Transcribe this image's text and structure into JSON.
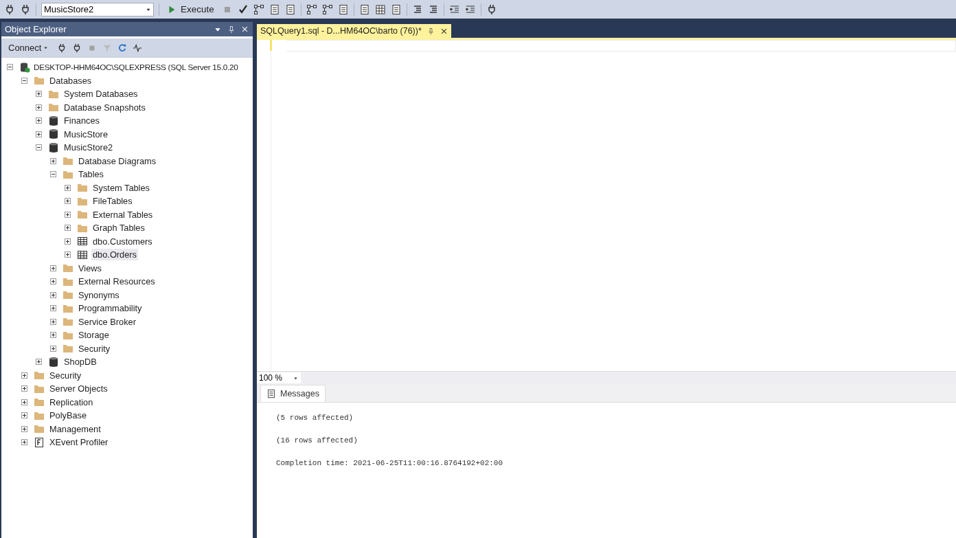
{
  "toolbar": {
    "database": "MusicStore2",
    "execute": "Execute"
  },
  "object_explorer": {
    "title": "Object Explorer",
    "connect": "Connect",
    "tree": [
      {
        "label": "DESKTOP-HHM64OC\\SQLEXPRESS (SQL Server 15.0.20",
        "kind": "server",
        "expanded": true,
        "selected": false,
        "children": [
          {
            "label": "Databases",
            "kind": "folder",
            "expanded": true,
            "selected": false,
            "children": [
              {
                "label": "System Databases",
                "kind": "folder",
                "expanded": false,
                "selected": false
              },
              {
                "label": "Database Snapshots",
                "kind": "folder",
                "expanded": false,
                "selected": false
              },
              {
                "label": "Finances",
                "kind": "database",
                "expanded": false,
                "selected": false
              },
              {
                "label": "MusicStore",
                "kind": "database",
                "expanded": false,
                "selected": false
              },
              {
                "label": "MusicStore2",
                "kind": "database",
                "expanded": true,
                "selected": false,
                "children": [
                  {
                    "label": "Database Diagrams",
                    "kind": "folder",
                    "expanded": false,
                    "selected": false
                  },
                  {
                    "label": "Tables",
                    "kind": "folder",
                    "expanded": true,
                    "selected": false,
                    "children": [
                      {
                        "label": "System Tables",
                        "kind": "folder",
                        "expanded": false,
                        "selected": false
                      },
                      {
                        "label": "FileTables",
                        "kind": "folder",
                        "expanded": false,
                        "selected": false
                      },
                      {
                        "label": "External Tables",
                        "kind": "folder",
                        "expanded": false,
                        "selected": false
                      },
                      {
                        "label": "Graph Tables",
                        "kind": "folder",
                        "expanded": false,
                        "selected": false
                      },
                      {
                        "label": "dbo.Customers",
                        "kind": "table",
                        "expanded": false,
                        "selected": false
                      },
                      {
                        "label": "dbo.Orders",
                        "kind": "table",
                        "expanded": false,
                        "selected": true
                      }
                    ]
                  },
                  {
                    "label": "Views",
                    "kind": "folder",
                    "expanded": false,
                    "selected": false
                  },
                  {
                    "label": "External Resources",
                    "kind": "folder",
                    "expanded": false,
                    "selected": false
                  },
                  {
                    "label": "Synonyms",
                    "kind": "folder",
                    "expanded": false,
                    "selected": false
                  },
                  {
                    "label": "Programmability",
                    "kind": "folder",
                    "expanded": false,
                    "selected": false
                  },
                  {
                    "label": "Service Broker",
                    "kind": "folder",
                    "expanded": false,
                    "selected": false
                  },
                  {
                    "label": "Storage",
                    "kind": "folder",
                    "expanded": false,
                    "selected": false
                  },
                  {
                    "label": "Security",
                    "kind": "folder",
                    "expanded": false,
                    "selected": false
                  }
                ]
              },
              {
                "label": "ShopDB",
                "kind": "database",
                "expanded": false,
                "selected": false
              }
            ]
          },
          {
            "label": "Security",
            "kind": "folder",
            "expanded": false,
            "selected": false
          },
          {
            "label": "Server Objects",
            "kind": "folder",
            "expanded": false,
            "selected": false
          },
          {
            "label": "Replication",
            "kind": "folder",
            "expanded": false,
            "selected": false
          },
          {
            "label": "PolyBase",
            "kind": "folder",
            "expanded": false,
            "selected": false
          },
          {
            "label": "Management",
            "kind": "folder",
            "expanded": false,
            "selected": false
          },
          {
            "label": "XEvent Profiler",
            "kind": "profiler",
            "expanded": false,
            "selected": false
          }
        ]
      }
    ]
  },
  "editor": {
    "tabs": [
      {
        "title": "SQLQuery1.sql - D...HM64OC\\barto (76))*",
        "selected": true
      }
    ],
    "zoom": "100 %"
  },
  "results": {
    "tabs": [
      {
        "label": "Messages",
        "selected": true
      }
    ],
    "messages": [
      "(5 rows affected)",
      "(16 rows affected)",
      "Completion time: 2021-06-25T11:00:16.8764192+02:00"
    ]
  }
}
